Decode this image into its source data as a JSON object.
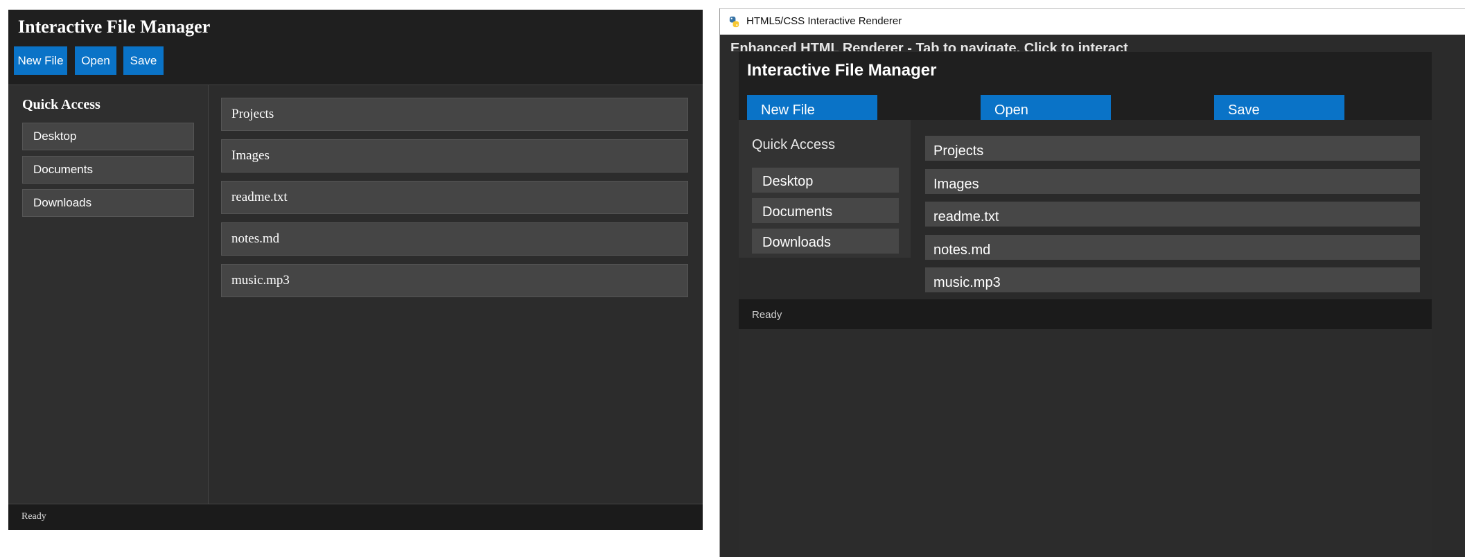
{
  "reference": {
    "title": "Interactive File Manager",
    "toolbar": {
      "new_label": "New File",
      "open_label": "Open",
      "save_label": "Save"
    },
    "sidebar": {
      "heading": "Quick Access",
      "items": [
        "Desktop",
        "Documents",
        "Downloads"
      ]
    },
    "files": [
      "Projects",
      "Images",
      "readme.txt",
      "notes.md",
      "music.mp3"
    ],
    "status": "Ready"
  },
  "renderer": {
    "window_title": "HTML5/CSS Interactive Renderer",
    "banner": "Enhanced HTML Renderer - Tab to navigate, Click to interact",
    "title": "Interactive File Manager",
    "toolbar": {
      "new_label": "New File",
      "open_label": "Open",
      "save_label": "Save"
    },
    "sidebar": {
      "heading": "Quick Access",
      "items": [
        "Desktop",
        "Documents",
        "Downloads"
      ]
    },
    "files": [
      "Projects",
      "Images",
      "readme.txt",
      "notes.md",
      "music.mp3"
    ],
    "status": "Ready"
  },
  "colors": {
    "accent": "#0a73c7",
    "header_bg": "#1f1f1f",
    "item_bg": "#454545"
  },
  "icons": {
    "window_icon": "python-snake-icon"
  }
}
